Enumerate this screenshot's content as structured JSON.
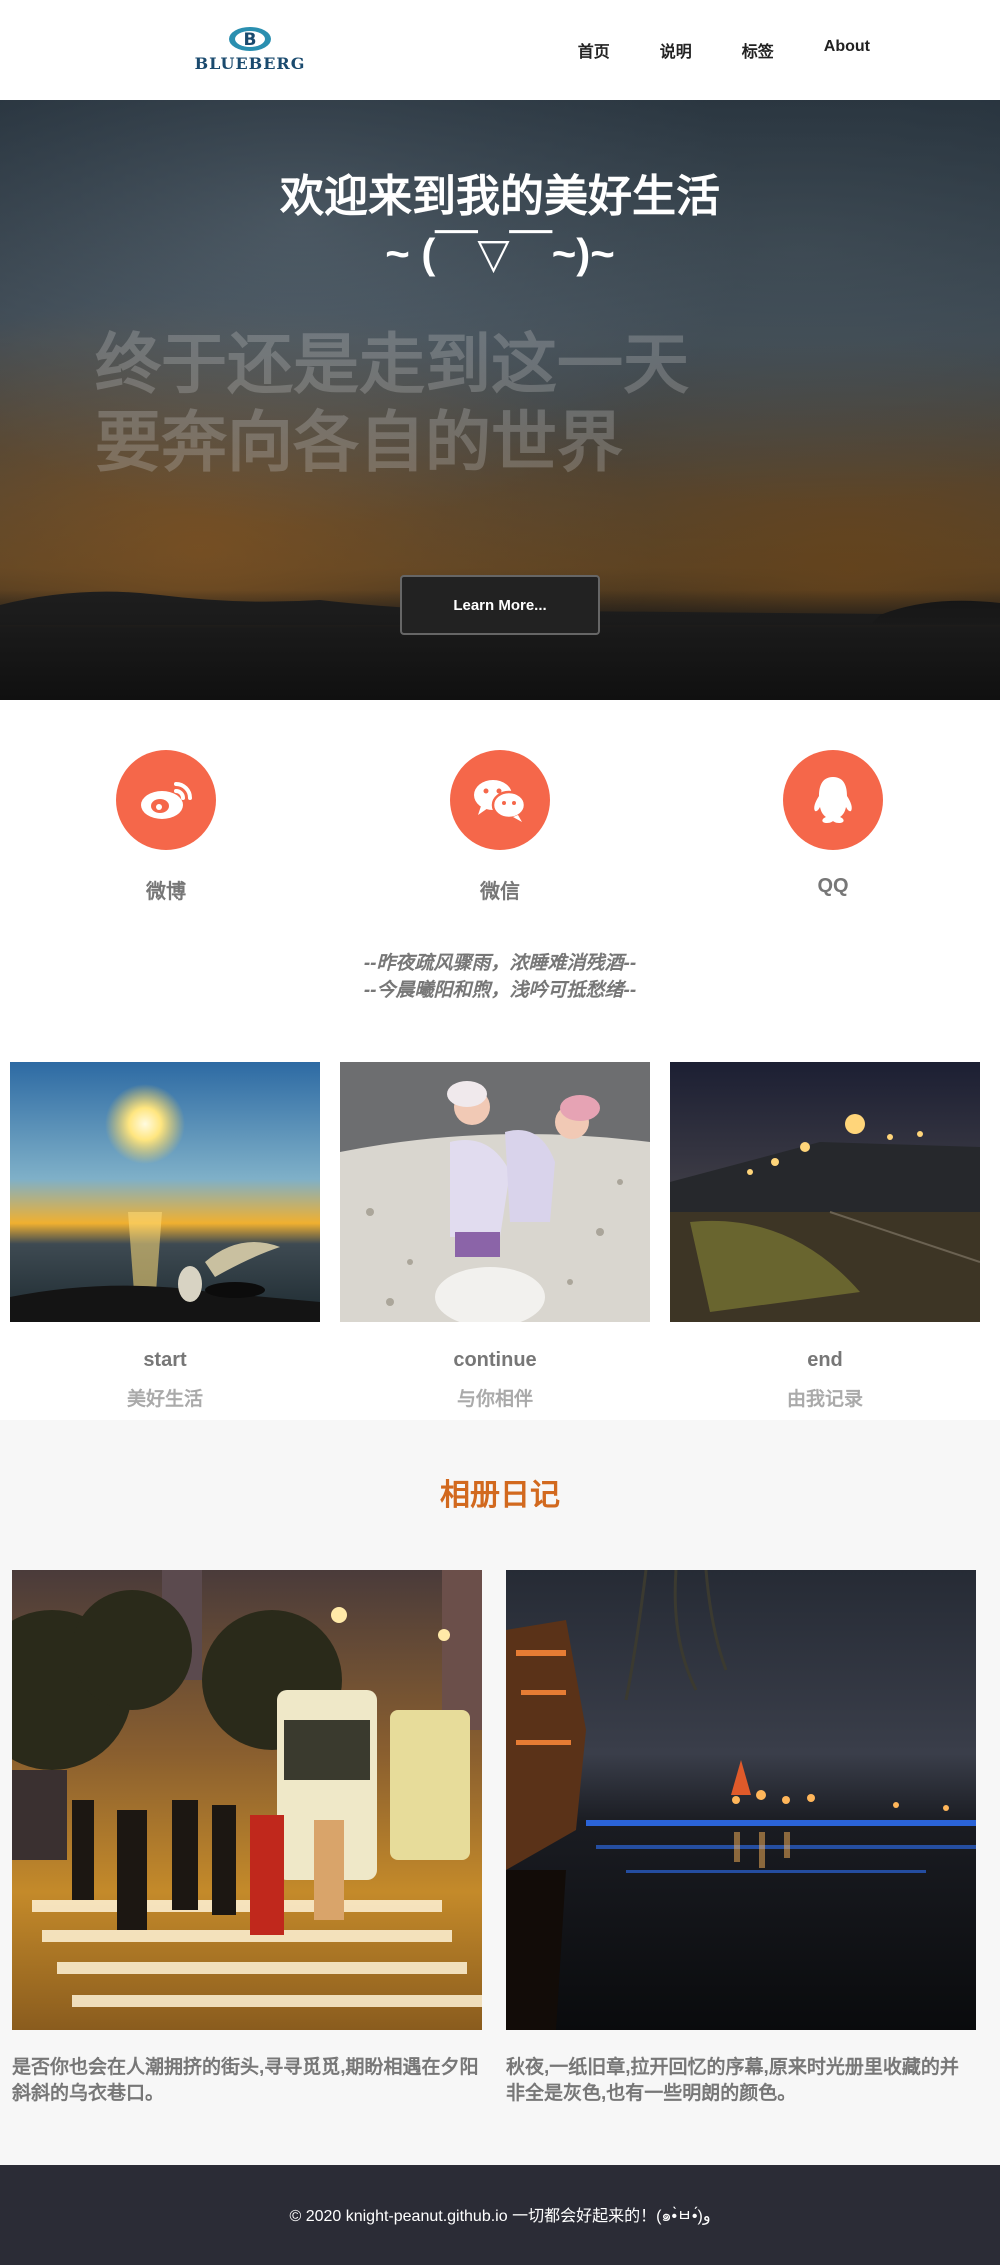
{
  "header": {
    "logo_text": "BLUEBERG",
    "nav": [
      "首页",
      "说明",
      "标签",
      "About"
    ]
  },
  "hero": {
    "title": "欢迎来到我的美好生活",
    "emoticon": "~ (￣▽￣~)~",
    "watermark_line1": "终于还是走到这一天",
    "watermark_line2": "要奔向各自的世界",
    "button_label": "Learn More..."
  },
  "social": [
    {
      "label": "微博",
      "icon": "weibo-icon"
    },
    {
      "label": "微信",
      "icon": "wechat-icon"
    },
    {
      "label": "QQ",
      "icon": "qq-icon"
    }
  ],
  "poem": {
    "line1": "--昨夜疏风骤雨，浓睡难消残酒--",
    "line2": "--今晨曦阳和煦，浅吟可抵愁绪--"
  },
  "cards": [
    {
      "title": "start",
      "subtitle": "美好生活"
    },
    {
      "title": "continue",
      "subtitle": "与你相伴"
    },
    {
      "title": "end",
      "subtitle": "由我记录"
    }
  ],
  "album": {
    "title": "相册日记",
    "items": [
      {
        "caption": "是否你也会在人潮拥挤的街头,寻寻觅觅,期盼相遇在夕阳斜斜的乌衣巷口。"
      },
      {
        "caption": "秋夜,一纸旧章,拉开回忆的序幕,原来时光册里收藏的并非全是灰色,也有一些明朗的颜色。"
      }
    ]
  },
  "footer": {
    "text": "© 2020 knight-peanut.github.io 一切都会好起来的！(๑•̀ㅂ•́)و"
  },
  "colors": {
    "accent": "#f5674a",
    "album_title": "#d2691e",
    "footer_bg": "#2b2c36",
    "logo": "#1a4a6e"
  }
}
